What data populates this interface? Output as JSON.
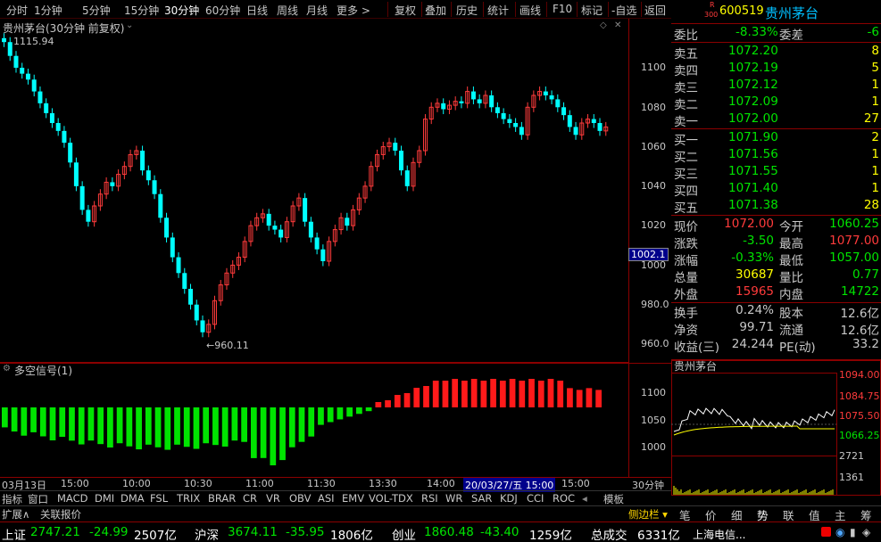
{
  "toolbar": {
    "periods": [
      "分时",
      "1分钟",
      "5分钟",
      "15分钟",
      "30分钟",
      "60分钟",
      "日线",
      "周线",
      "月线",
      "更多 >"
    ],
    "active_period": "30分钟",
    "actions": [
      "复权",
      "叠加",
      "历史",
      "统计",
      "画线",
      "F10",
      "标记",
      "-自选",
      "返回"
    ]
  },
  "stock": {
    "r_label": "R",
    "r_num": "300",
    "code": "600519",
    "name": "贵州茅台"
  },
  "main_chart": {
    "title": "贵州茅台(30分钟 前复权)",
    "high_label": "1115.94",
    "low_label": "←960.11",
    "y_ticks": [
      "1100",
      "1080",
      "1060",
      "1040",
      "1020",
      "1000",
      "980.0",
      "960.0"
    ],
    "current_tag": "1002.1"
  },
  "indicator": {
    "title": "多空信号(1)",
    "y_ticks": [
      "1100",
      "1050",
      "1000"
    ]
  },
  "x_axis": {
    "labels": [
      "03月13日",
      "15:00",
      "10:00",
      "10:30",
      "11:00",
      "11:30",
      "13:30",
      "14:00",
      "14:30",
      "15:00"
    ],
    "cursor_date": "20/03/27/五",
    "cursor_time": "15:00",
    "period": "30分钟"
  },
  "indicator_tabs": [
    "指标",
    "窗口",
    "MACD",
    "DMI",
    "DMA",
    "FSL",
    "TRIX",
    "BRAR",
    "CR",
    "VR",
    "OBV",
    "ASI",
    "EMV",
    "VOL-TDX",
    "RSI",
    "WR",
    "SAR",
    "KDJ",
    "CCI",
    "ROC",
    "模板"
  ],
  "bottom_left": [
    "扩展∧",
    "关联报价"
  ],
  "side_bar": {
    "label": "侧边栏 ▾"
  },
  "quote": {
    "weibi": {
      "label": "委比",
      "value": "-8.33%",
      "label2": "委差",
      "value2": "-6"
    },
    "asks": [
      {
        "label": "卖五",
        "price": "1072.20",
        "vol": "8"
      },
      {
        "label": "卖四",
        "price": "1072.19",
        "vol": "5"
      },
      {
        "label": "卖三",
        "price": "1072.12",
        "vol": "1"
      },
      {
        "label": "卖二",
        "price": "1072.09",
        "vol": "1"
      },
      {
        "label": "卖一",
        "price": "1072.00",
        "vol": "27"
      }
    ],
    "bids": [
      {
        "label": "买一",
        "price": "1071.90",
        "vol": "2"
      },
      {
        "label": "买二",
        "price": "1071.56",
        "vol": "1"
      },
      {
        "label": "买三",
        "price": "1071.55",
        "vol": "1"
      },
      {
        "label": "买四",
        "price": "1071.40",
        "vol": "1"
      },
      {
        "label": "买五",
        "price": "1071.38",
        "vol": "28"
      }
    ],
    "stats": [
      {
        "l1": "现价",
        "v1": "1072.00",
        "c1": "#ff3b3b",
        "l2": "今开",
        "v2": "1060.25",
        "c2": "#00e400"
      },
      {
        "l1": "涨跌",
        "v1": "-3.50",
        "c1": "#00e400",
        "l2": "最高",
        "v2": "1077.00",
        "c2": "#ff3b3b"
      },
      {
        "l1": "涨幅",
        "v1": "-0.33%",
        "c1": "#00e400",
        "l2": "最低",
        "v2": "1057.00",
        "c2": "#00e400"
      },
      {
        "l1": "总量",
        "v1": "30687",
        "c1": "#ffff00",
        "l2": "量比",
        "v2": "0.77",
        "c2": "#00e400"
      },
      {
        "l1": "外盘",
        "v1": "15965",
        "c1": "#ff3b3b",
        "l2": "内盘",
        "v2": "14722",
        "c2": "#00e400"
      }
    ],
    "stats2": [
      {
        "l1": "换手",
        "v1": "0.24%",
        "l2": "股本",
        "v2": "12.6亿"
      },
      {
        "l1": "净资",
        "v1": "99.71",
        "l2": "流通",
        "v2": "12.6亿"
      },
      {
        "l1": "收益(三)",
        "v1": "24.244",
        "l2": "PE(动)",
        "v2": "33.2"
      }
    ]
  },
  "mini_chart": {
    "title": "贵州茅台",
    "y_ticks": [
      "1094.00",
      "1084.75",
      "1075.50",
      "1066.25",
      "2721",
      "1361"
    ]
  },
  "side_tabs": [
    "笔",
    "价",
    "细",
    "势",
    "联",
    "值",
    "主",
    "筹"
  ],
  "active_side_tab": "势",
  "indices": [
    {
      "name": "上证",
      "value": "2747.21",
      "change": "-24.99",
      "amount": "2507亿"
    },
    {
      "name": "沪深",
      "value": "3674.11",
      "change": "-35.95",
      "amount": "1806亿"
    },
    {
      "name": "创业",
      "value": "1860.48",
      "change": "-43.40",
      "amount": "1259亿"
    }
  ],
  "total": {
    "label": "总成交",
    "value": "6331亿"
  },
  "ticker": "上海电信..."
}
